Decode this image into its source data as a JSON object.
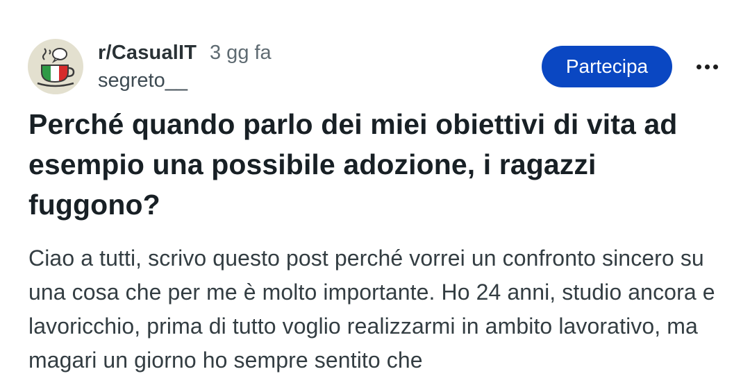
{
  "header": {
    "subreddit": "r/CasualIT",
    "time_ago": "3 gg fa",
    "author": "segreto__",
    "avatar_icon": "italian-coffee-cup-icon",
    "join_label": "Partecipa",
    "more_icon": "more-options-icon"
  },
  "post": {
    "title": "Perché quando parlo dei miei obiettivi di vita ad esempio una possibile adozione, i ragazzi fuggono?",
    "body": "Ciao a tutti, scrivo questo post perché vorrei un confronto sincero su una cosa che per me è molto importante. Ho 24 anni, studio ancora e lavoricchio, prima di tutto voglio realizzarmi in ambito lavorativo, ma magari un giorno ho sempre sentito che"
  },
  "colors": {
    "join_button": "#0a47c2",
    "avatar_bg": "#e3e0cf"
  }
}
